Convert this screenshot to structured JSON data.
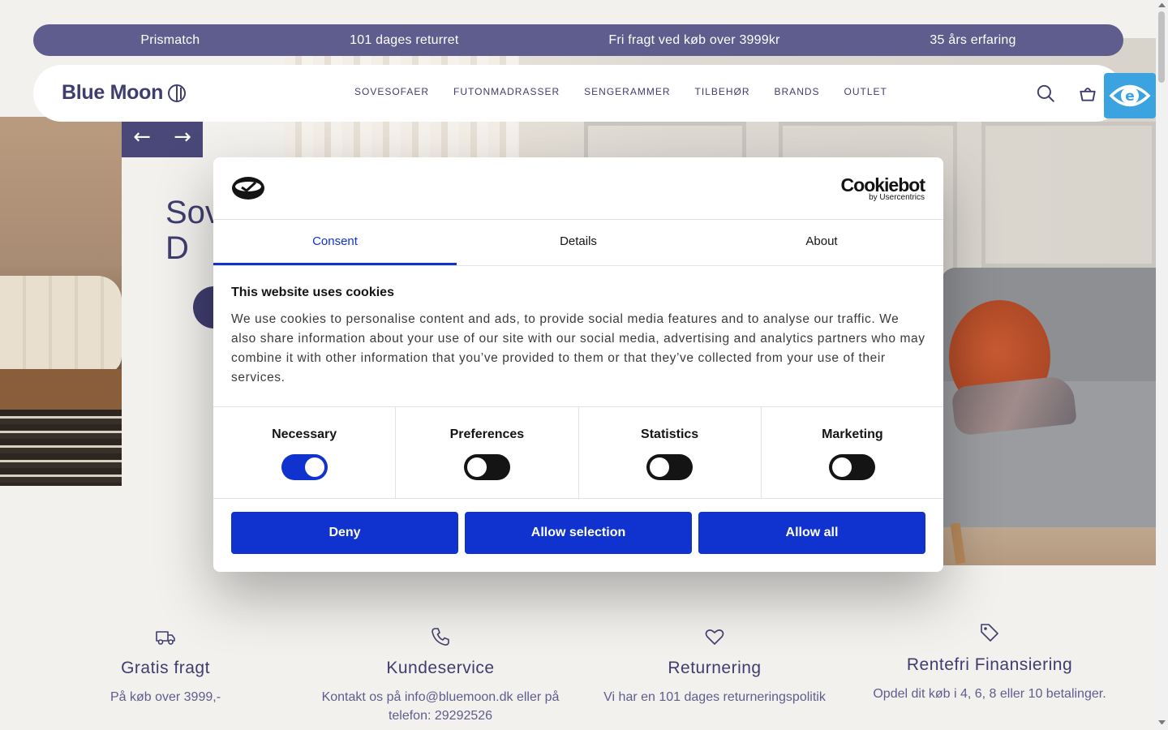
{
  "usp_bar": [
    "Prismatch",
    "101 dages returret",
    "Fri fragt ved køb over 3999kr",
    "35 års erfaring"
  ],
  "header": {
    "logo": "Blue Moon",
    "nav": [
      "SOVESOFAER",
      "FUTONMADRASSER",
      "SENGERAMMER",
      "TILBEHØR",
      "BRANDS",
      "OUTLET"
    ]
  },
  "hero": {
    "title": "Sov\nD"
  },
  "features": [
    {
      "title": "Gratis fragt",
      "text": "På køb over 3999,-",
      "icon": "truck-icon"
    },
    {
      "title": "Kundeservice",
      "text": "Kontakt os på info@bluemoon.dk eller på telefon: 29292526",
      "icon": "phone-icon"
    },
    {
      "title": "Returnering",
      "text": "Vi har en 101 dages returneringspolitik",
      "icon": "heart-icon"
    },
    {
      "title": "Rentefri Finansiering",
      "text": "Opdel dit køb i 4, 6, 8 eller 10 betalinger.",
      "icon": "tag-icon"
    }
  ],
  "cookie_dialog": {
    "brand": "Cookiebot",
    "brand_sub": "by Usercentrics",
    "tabs": [
      "Consent",
      "Details",
      "About"
    ],
    "active_tab": "Consent",
    "title": "This website uses cookies",
    "text": "We use cookies to personalise content and ads, to provide social media features and to analyse our traffic. We also share information about your use of our site with our social media, advertising and analytics partners who may combine it with other information that you’ve provided to them or that they’ve collected from your use of their services.",
    "toggles": [
      {
        "label": "Necessary",
        "on": true
      },
      {
        "label": "Preferences",
        "on": false
      },
      {
        "label": "Statistics",
        "on": false
      },
      {
        "label": "Marketing",
        "on": false
      }
    ],
    "buttons": [
      "Deny",
      "Allow selection",
      "Allow all"
    ]
  },
  "colors": {
    "brand": "#3f3d6e",
    "usp_bar": "#5e5d8d",
    "cookie_blue": "#1032cf"
  }
}
